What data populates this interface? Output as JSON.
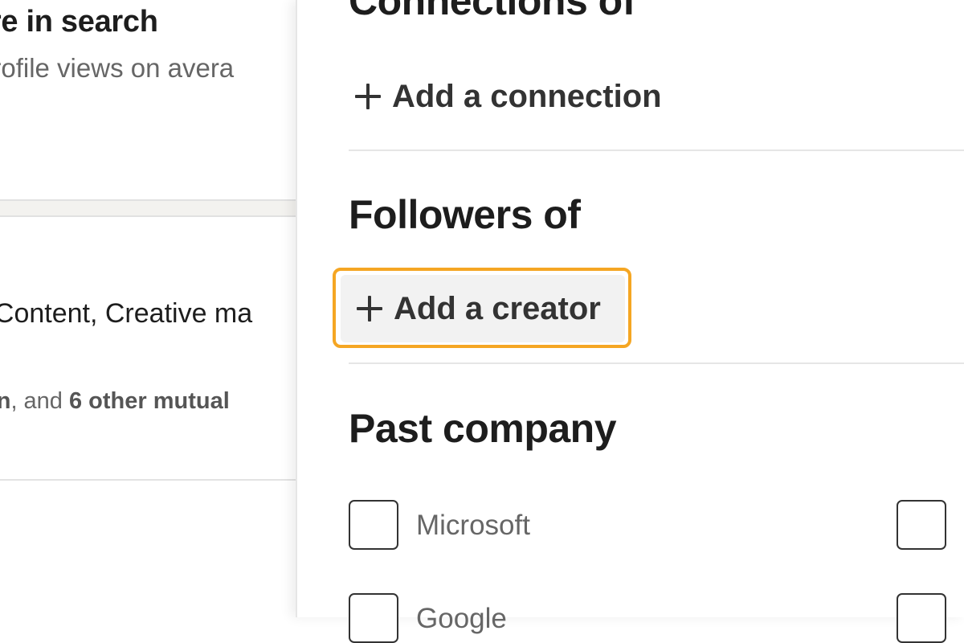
{
  "background_page": {
    "heading_fragment": "ore in search",
    "subtext_fragment": "profile views on avera",
    "result_title_fragment": "f Content, Creative ma",
    "mutual": {
      "name_fragment": "on",
      "middle": ", and ",
      "others": "6 other mutual"
    }
  },
  "filters": {
    "connections_of": {
      "title": "Connections of",
      "add_label": "Add a connection"
    },
    "followers_of": {
      "title": "Followers of",
      "add_label": "Add a creator"
    },
    "past_company": {
      "title": "Past company",
      "options": [
        {
          "label": "Microsoft",
          "checked": false
        },
        {
          "label": "Google",
          "checked": false
        }
      ]
    }
  },
  "colors": {
    "focus_outline": "#f5a623",
    "button_hover_bg": "#f2f2f2",
    "text_primary": "#1d1d1d",
    "text_secondary": "#666666"
  }
}
